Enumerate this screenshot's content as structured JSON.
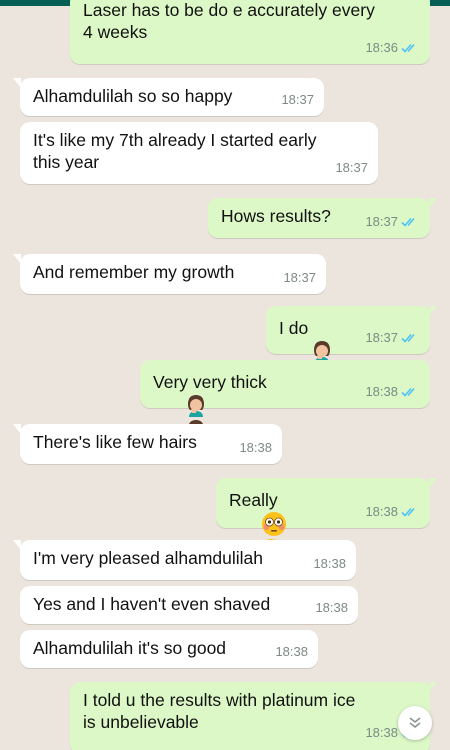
{
  "messages": [
    {
      "dir": "out",
      "text": "Laser has to be do e accurately every\n4 weeks",
      "time": "18:36",
      "ticks": true
    },
    {
      "dir": "in",
      "text": "Alhamdulilah so so happy",
      "time": "18:37"
    },
    {
      "dir": "in",
      "text": "It's like my 7th already I started early\nthis year",
      "time": "18:37"
    },
    {
      "dir": "out",
      "text": "Hows results?",
      "time": "18:37",
      "ticks": true
    },
    {
      "dir": "in",
      "text": "And remember my growth",
      "time": "18:37"
    },
    {
      "dir": "out",
      "text": "I do",
      "time": "18:37",
      "ticks": true,
      "emojis": [
        "woman-facepalming-emoji"
      ]
    },
    {
      "dir": "out",
      "text": "Very very thick",
      "time": "18:38",
      "ticks": true,
      "emojis": [
        "woman-facepalming-emoji",
        "woman-facepalming-emoji"
      ]
    },
    {
      "dir": "in",
      "text": "There's like few hairs",
      "time": "18:38"
    },
    {
      "dir": "out",
      "text": "Really",
      "time": "18:38",
      "ticks": true,
      "emojis": [
        "flushed-face-emoji",
        "flushed-face-emoji"
      ]
    },
    {
      "dir": "in",
      "text": "I'm very pleased alhamdulilah",
      "time": "18:38"
    },
    {
      "dir": "in",
      "text": "Yes and I haven't even shaved",
      "time": "18:38"
    },
    {
      "dir": "in",
      "text": "Alhamdulilah it's so good",
      "time": "18:38"
    },
    {
      "dir": "out",
      "text": "I told u the results with platinum ice\nis unbelievable",
      "time": "18:38",
      "ticks": true
    }
  ],
  "icons": {
    "read_ticks": "double-check-icon",
    "scroll_down": "double-chevron-down-icon"
  },
  "colors": {
    "incoming": "#ffffff",
    "outgoing": "#dcf8c6",
    "read_tick": "#4fc3f7",
    "background": "#ece5dd"
  }
}
